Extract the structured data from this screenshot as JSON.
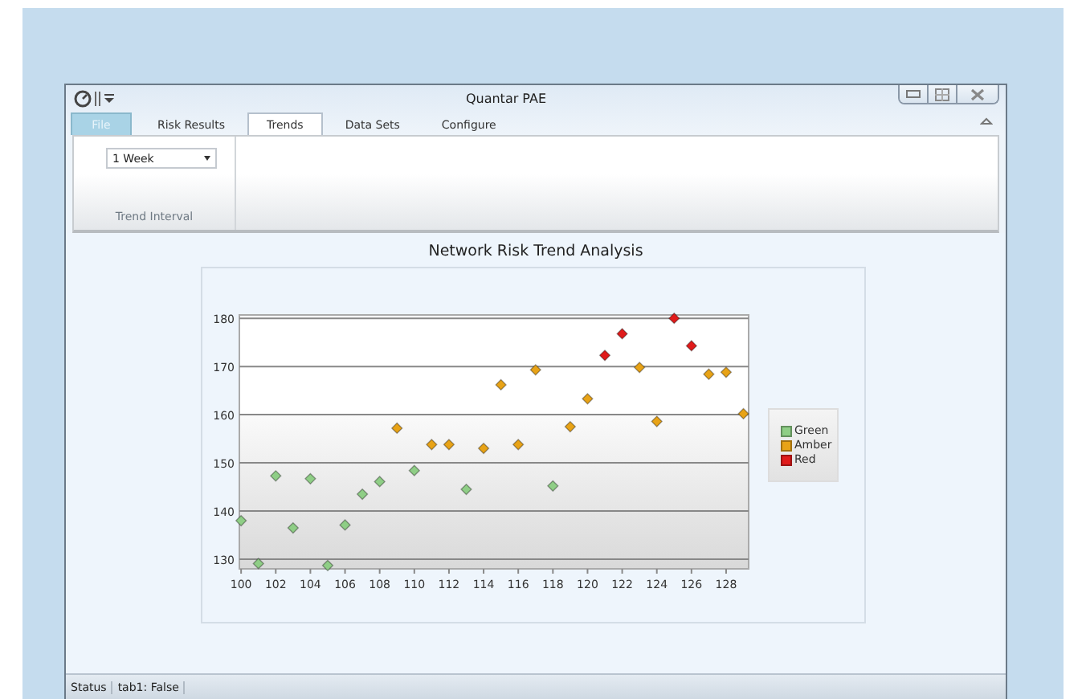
{
  "window": {
    "title": "Quantar PAE"
  },
  "tabs": [
    {
      "label": "File",
      "kind": "file",
      "selected": false
    },
    {
      "label": "Risk Results",
      "kind": "tab",
      "selected": false
    },
    {
      "label": "Trends",
      "kind": "tab",
      "selected": true
    },
    {
      "label": "Data Sets",
      "kind": "tab",
      "selected": false
    },
    {
      "label": "Configure",
      "kind": "tab",
      "selected": false
    }
  ],
  "ribbon": {
    "groups": [
      {
        "label": "Trend Interval",
        "dropdown": {
          "value": "1 Week"
        }
      }
    ]
  },
  "chart": {
    "title": "Network Risk Trend Analysis",
    "chart_data": {
      "type": "scatter",
      "x": [
        100,
        101,
        102,
        103,
        104,
        105,
        106,
        107,
        108,
        109,
        110,
        111,
        112,
        113,
        114,
        115,
        116,
        117,
        118,
        119,
        120,
        121,
        122,
        123,
        124,
        125,
        126,
        127,
        128,
        129
      ],
      "series": [
        {
          "name": "Green",
          "color": "#8fce86",
          "values": [
            138,
            129.1,
            147.3,
            136.5,
            146.7,
            128.7,
            137.1,
            143.5,
            146.1,
            null,
            148.4,
            null,
            null,
            144.5,
            null,
            null,
            null,
            null,
            145.2,
            null,
            null,
            null,
            null,
            null,
            null,
            null,
            null,
            null,
            null,
            null
          ]
        },
        {
          "name": "Amber",
          "color": "#e8a317",
          "values": [
            null,
            null,
            null,
            null,
            null,
            null,
            null,
            null,
            null,
            157.2,
            null,
            153.8,
            153.8,
            null,
            153,
            166.2,
            153.8,
            169.3,
            null,
            157.5,
            163.3,
            null,
            null,
            169.8,
            158.6,
            null,
            null,
            168.4,
            168.8,
            160.2
          ]
        },
        {
          "name": "Red",
          "color": "#e01b1b",
          "values": [
            null,
            null,
            null,
            null,
            null,
            null,
            null,
            null,
            null,
            null,
            null,
            null,
            null,
            null,
            null,
            null,
            null,
            null,
            null,
            null,
            null,
            172.3,
            176.8,
            null,
            null,
            180,
            174.3,
            null,
            null,
            null
          ]
        }
      ],
      "xlim": [
        99.9,
        129.3
      ],
      "ylim": [
        128,
        180.7
      ],
      "xticks": [
        100,
        102,
        104,
        106,
        108,
        110,
        112,
        114,
        116,
        118,
        120,
        122,
        124,
        126,
        128
      ],
      "yticks": [
        130,
        140,
        150,
        160,
        170,
        180
      ],
      "grid": true,
      "bands": [
        {
          "axis": "y",
          "from": 128,
          "to": 160
        }
      ]
    }
  },
  "status_bar": [
    "Status",
    "tab1: False"
  ]
}
